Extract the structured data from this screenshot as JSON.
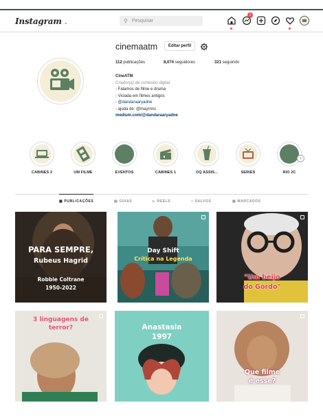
{
  "app": {
    "logo": "Instagram",
    "logo_chevron": "⌄"
  },
  "search": {
    "placeholder": "Pesquisar"
  },
  "nav": {
    "notification_count": "1"
  },
  "profile": {
    "username": "cinemaatm",
    "edit_label": "Editar perfil",
    "posts_count": "112",
    "posts_label": " publicações",
    "followers_count": "8,074",
    "followers_label": " seguidores",
    "following_count": "321",
    "following_label": " seguindo",
    "bio": {
      "name": "CineATM",
      "category": "Criador(a) de conteúdo digital",
      "lines": [
        "- Falamos de filme e drama",
        "- Viciada em filmes antigos"
      ],
      "mention1": "- @dandaraaryadne",
      "helper": "- ajuda de: @mayrnns",
      "url": "medium.com/@dandaraaryadne"
    }
  },
  "highlights": [
    {
      "label": "CABINES 2"
    },
    {
      "label": "UM FILME"
    },
    {
      "label": "EVENTOS"
    },
    {
      "label": "CABINES 1"
    },
    {
      "label": "OQ ASSIS..."
    },
    {
      "label": "SERIES"
    },
    {
      "label": "RIO 2C"
    }
  ],
  "tabs": [
    {
      "label": "PUBLICAÇÕES"
    },
    {
      "label": "GUIAS"
    },
    {
      "label": "REELS"
    },
    {
      "label": "SALVOS"
    },
    {
      "label": "MARCADOS"
    }
  ],
  "posts": [
    {
      "line1": "PARA SEMPRE,",
      "line2": "Rubeus Hagrid",
      "line3": "Robbie Coltrane",
      "line4": "1950-2022"
    },
    {
      "line1": "Day Shift",
      "line2": "Crítica na Legenda"
    },
    {
      "line1": "\"Um beijo",
      "line2": "do Gordo\""
    },
    {
      "line1": "3 linguagens de",
      "line2": "terror?"
    },
    {
      "line1": "Anastasia",
      "line2": "1997"
    },
    {
      "line1": "Que filme",
      "line2": "é esse?"
    }
  ],
  "colors": {
    "accent": "#2b5f5d",
    "highlight_green": "#5d7f63",
    "link": "#00376b",
    "badge": "#ed4956"
  }
}
